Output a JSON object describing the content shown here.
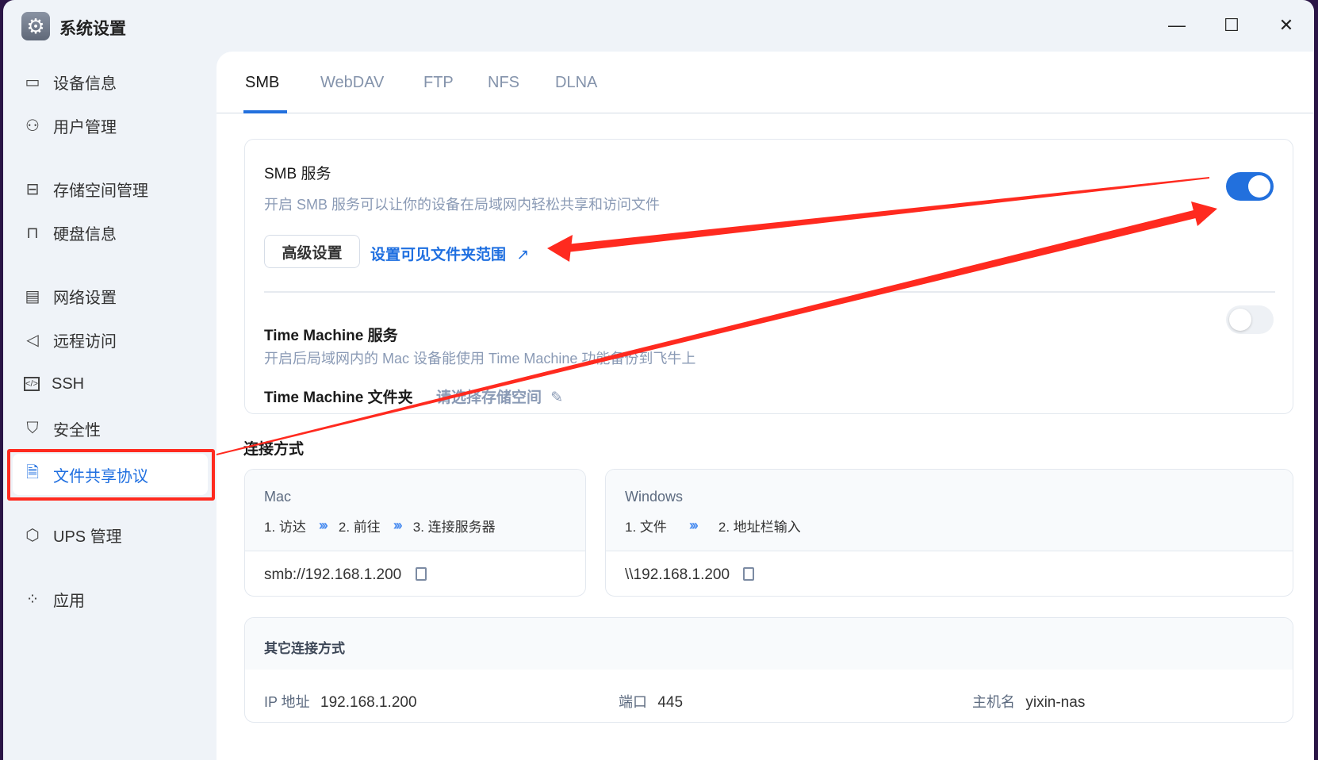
{
  "window": {
    "title": "系统设置",
    "app_icon": "gear-icon",
    "controls": {
      "minimize": "—",
      "maximize": "☐",
      "close": "✕"
    }
  },
  "sidebar": {
    "items": [
      {
        "label": "设备信息",
        "icon": "device-icon"
      },
      {
        "label": "用户管理",
        "icon": "user-gear-icon"
      },
      {
        "label": "存储空间管理",
        "icon": "storage-icon"
      },
      {
        "label": "硬盘信息",
        "icon": "disk-icon"
      },
      {
        "label": "网络设置",
        "icon": "network-icon"
      },
      {
        "label": "远程访问",
        "icon": "send-icon"
      },
      {
        "label": "SSH",
        "icon": "code-icon"
      },
      {
        "label": "安全性",
        "icon": "shield-check-icon"
      },
      {
        "label": "文件共享协议",
        "icon": "document-icon",
        "active": true
      },
      {
        "label": "UPS 管理",
        "icon": "shield-icon"
      },
      {
        "label": "应用",
        "icon": "apps-icon"
      }
    ]
  },
  "tabs": [
    {
      "label": "SMB",
      "active": true
    },
    {
      "label": "WebDAV"
    },
    {
      "label": "FTP"
    },
    {
      "label": "NFS"
    },
    {
      "label": "DLNA"
    }
  ],
  "smb": {
    "title": "SMB 服务",
    "desc": "开启 SMB 服务可以让你的设备在局域网内轻松共享和访问文件",
    "enabled": true,
    "advanced_button": "高级设置",
    "folder_scope_link": "设置可见文件夹范围"
  },
  "time_machine": {
    "title": "Time Machine 服务",
    "desc": "开启后局域网内的 Mac 设备能使用 Time Machine 功能备份到飞牛上",
    "enabled": false,
    "folder_label": "Time Machine 文件夹",
    "folder_value": "请选择存储空间"
  },
  "connection": {
    "heading": "连接方式",
    "mac": {
      "title": "Mac",
      "steps": [
        "1. 访达",
        "2. 前往",
        "3. 连接服务器"
      ],
      "address": "smb://192.168.1.200"
    },
    "windows": {
      "title": "Windows",
      "steps": [
        "1. 文件",
        "2. 地址栏输入"
      ],
      "address": "\\\\192.168.1.200"
    },
    "chevron": "›››"
  },
  "other": {
    "title": "其它连接方式",
    "ip_label": "IP 地址",
    "ip": "192.168.1.200",
    "port_label": "端口",
    "port": "445",
    "host_label": "主机名",
    "host": "yixin-nas"
  },
  "colors": {
    "accent": "#2270dd",
    "annotation": "#ff2a1f"
  }
}
